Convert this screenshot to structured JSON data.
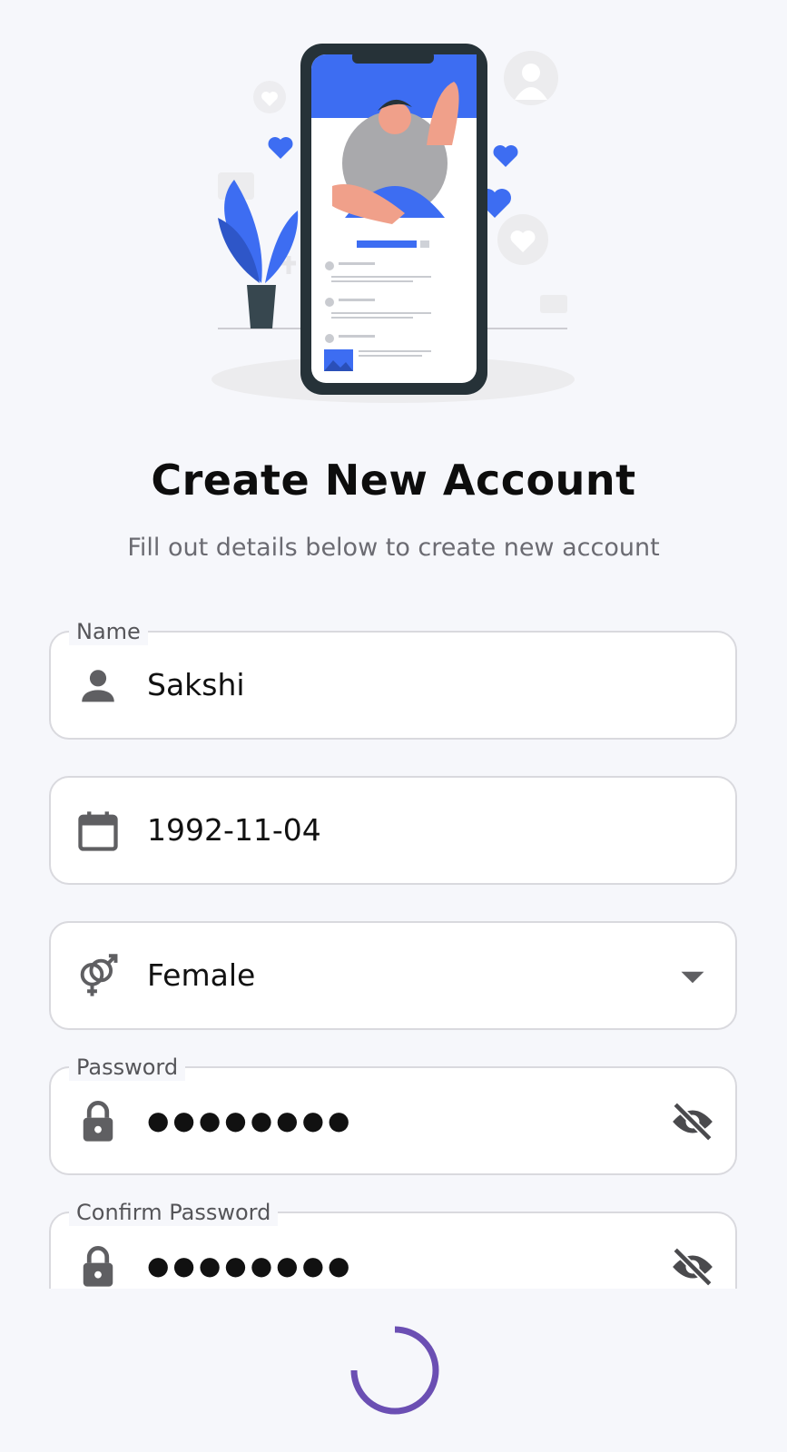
{
  "header": {
    "title": "Create New Account",
    "subtitle": "Fill out details below to create new account"
  },
  "form": {
    "name": {
      "label": "Name",
      "value": "Sakshi",
      "icon": "person-icon"
    },
    "dob": {
      "value": "1992-11-04",
      "icon": "calendar-icon"
    },
    "gender": {
      "value": "Female",
      "icon": "gender-icon",
      "trailing_icon": "dropdown-arrow-icon"
    },
    "password": {
      "label": "Password",
      "value": "●●●●●●●●",
      "icon": "lock-icon",
      "trailing_icon": "visibility-off-icon"
    },
    "confirm_password": {
      "label": "Confirm Password",
      "value": "●●●●●●●●",
      "icon": "lock-icon",
      "trailing_icon": "visibility-off-icon"
    }
  },
  "loading": {
    "icon": "loading-spinner"
  },
  "colors": {
    "accent": "#3d6df2",
    "spinner": "#6b4fb3",
    "background": "#f6f7fb",
    "icon_gray": "#5f5f62"
  }
}
